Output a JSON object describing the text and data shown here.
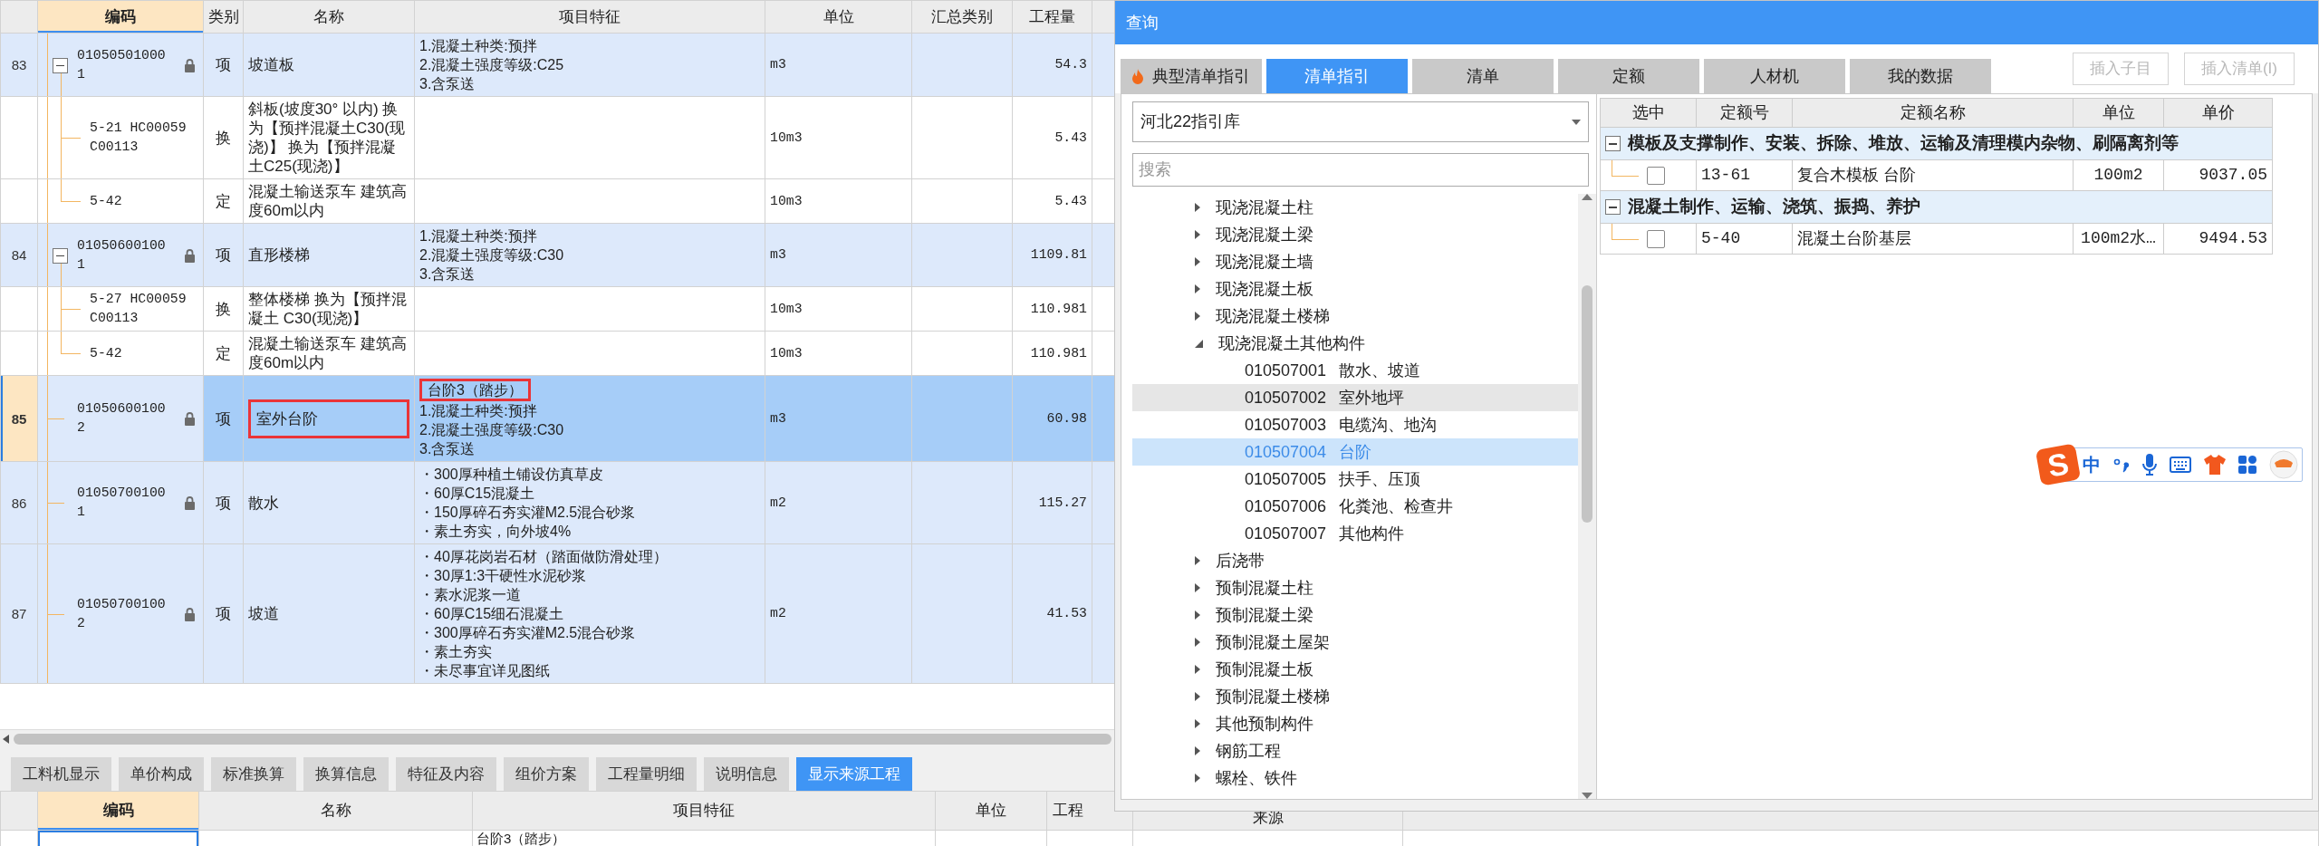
{
  "main_grid": {
    "columns": [
      {
        "label": "编码",
        "selected": true
      },
      {
        "label": "类别",
        "selected": false
      },
      {
        "label": "名称",
        "selected": false
      },
      {
        "label": "项目特征",
        "selected": false
      },
      {
        "label": "单位",
        "selected": false
      },
      {
        "label": "汇总类别",
        "selected": false
      },
      {
        "label": "工程量",
        "selected": false
      }
    ],
    "rows": [
      {
        "kind": "item",
        "no": "83",
        "code": "010505010001",
        "locked": true,
        "expanded": true,
        "type": "项",
        "name": "坡道板",
        "features": [
          "1.混凝土种类:预拌",
          "2.混凝土强度等级:C25",
          "3.含泵送"
        ],
        "unit": "m3",
        "quantity": "54.3",
        "selected": false,
        "highlighted": false
      },
      {
        "kind": "sub",
        "code": "5-21 HC00059 C00113",
        "type": "换",
        "name": "斜板(坡度30° 以内) 换为【预拌混凝土C30(现浇)】 换为【预拌混凝土C25(现浇)】",
        "unit": "10m3",
        "quantity": "5.43",
        "selected": false,
        "highlighted": false
      },
      {
        "kind": "sub",
        "code": "5-42",
        "type": "定",
        "name": "混凝土输送泵车 建筑高度60m以内",
        "unit": "10m3",
        "quantity": "5.43",
        "selected": false,
        "highlighted": false
      },
      {
        "kind": "item",
        "no": "84",
        "code": "010506001001",
        "locked": true,
        "expanded": true,
        "type": "项",
        "name": "直形楼梯",
        "features": [
          "1.混凝土种类:预拌",
          "2.混凝土强度等级:C30",
          "3.含泵送"
        ],
        "unit": "m3",
        "quantity": "1109.81",
        "selected": false,
        "highlighted": false
      },
      {
        "kind": "sub",
        "code": "5-27 HC00059 C00113",
        "type": "换",
        "name": "整体楼梯 换为【预拌混凝土 C30(现浇)】",
        "unit": "10m3",
        "quantity": "110.981",
        "selected": false,
        "highlighted": false
      },
      {
        "kind": "sub",
        "code": "5-42",
        "type": "定",
        "name": "混凝土输送泵车 建筑高度60m以内",
        "unit": "10m3",
        "quantity": "110.981",
        "selected": false,
        "highlighted": false
      },
      {
        "kind": "item",
        "no": "85",
        "code": "010506001002",
        "locked": true,
        "type": "项",
        "name": "室外台阶",
        "features": [
          "台阶3（踏步）",
          "1.混凝土种类:预拌",
          "2.混凝土强度等级:C30",
          "3.含泵送"
        ],
        "unit": "m3",
        "quantity": "60.98",
        "selected": true,
        "highlighted": true
      },
      {
        "kind": "item",
        "no": "86",
        "code": "010507001001",
        "locked": true,
        "type": "项",
        "name": "散水",
        "features": [
          "・300厚种植土铺设仿真草皮",
          "・60厚C15混凝土",
          "・150厚碎石夯实灌M2.5混合砂浆",
          "・素土夯实，向外坡4%"
        ],
        "unit": "m2",
        "quantity": "115.27",
        "selected": false,
        "highlighted": false
      },
      {
        "kind": "item",
        "no": "87",
        "code": "010507001002",
        "locked": true,
        "type": "项",
        "name": "坡道",
        "features": [
          "・40厚花岗岩石材（踏面做防滑处理）",
          "・30厚1:3干硬性水泥砂浆",
          "・素水泥浆一道",
          "・60厚C15细石混凝土",
          "・300厚碎石夯实灌M2.5混合砂浆",
          "・素土夯实",
          "・未尽事宜详见图纸"
        ],
        "unit": "m2",
        "quantity": "41.53",
        "selected": false,
        "highlighted": false
      }
    ]
  },
  "bottom_tabs": [
    {
      "label": "工料机显示",
      "selected": false
    },
    {
      "label": "单价构成",
      "selected": false
    },
    {
      "label": "标准换算",
      "selected": false
    },
    {
      "label": "换算信息",
      "selected": false
    },
    {
      "label": "特征及内容",
      "selected": false
    },
    {
      "label": "组价方案",
      "selected": false
    },
    {
      "label": "工程量明细",
      "selected": false
    },
    {
      "label": "说明信息",
      "selected": false
    },
    {
      "label": "显示来源工程",
      "selected": true
    }
  ],
  "bottom_grid": {
    "columns": [
      {
        "label": "编码",
        "selected": true
      },
      {
        "label": "名称",
        "selected": false
      },
      {
        "label": "项目特征",
        "selected": false
      },
      {
        "label": "单位",
        "selected": false
      },
      {
        "label": "工程",
        "selected": false
      },
      {
        "label": "来源",
        "selected": false
      }
    ],
    "rows": [
      {
        "features": "台阶3（踏步）",
        "selected": true
      }
    ]
  },
  "dialog": {
    "title": "查询",
    "tabs": [
      {
        "label": "典型清单指引",
        "selected": false
      },
      {
        "label": "清单指引",
        "selected": true
      },
      {
        "label": "清单",
        "selected": false
      },
      {
        "label": "定额",
        "selected": false
      },
      {
        "label": "人材机",
        "selected": false
      },
      {
        "label": "我的数据",
        "selected": false
      }
    ],
    "buttons": [
      {
        "label": "插入子目",
        "disabled": true
      },
      {
        "label": "插入清单(I)",
        "disabled": true
      }
    ],
    "library": "河北22指引库",
    "search": {
      "placeholder": "搜索"
    },
    "tree": [
      {
        "label": "现浇混凝土柱",
        "expanded": false
      },
      {
        "label": "现浇混凝土梁",
        "expanded": false
      },
      {
        "label": "现浇混凝土墙",
        "expanded": false
      },
      {
        "label": "现浇混凝土板",
        "expanded": false
      },
      {
        "label": "现浇混凝土楼梯",
        "expanded": false
      },
      {
        "label": "现浇混凝土其他构件",
        "expanded": true,
        "children": [
          {
            "code": "010507001",
            "label": "散水、坡道",
            "selected": false,
            "hovered": false
          },
          {
            "code": "010507002",
            "label": "室外地坪",
            "selected": false,
            "hovered": true
          },
          {
            "code": "010507003",
            "label": "电缆沟、地沟",
            "selected": false,
            "hovered": false
          },
          {
            "code": "010507004",
            "label": "台阶",
            "selected": true,
            "hovered": false
          },
          {
            "code": "010507005",
            "label": "扶手、压顶",
            "selected": false,
            "hovered": false
          },
          {
            "code": "010507006",
            "label": "化粪池、检查井",
            "selected": false,
            "hovered": false
          },
          {
            "code": "010507007",
            "label": "其他构件",
            "selected": false,
            "hovered": false
          }
        ]
      },
      {
        "label": "后浇带",
        "expanded": false
      },
      {
        "label": "预制混凝土柱",
        "expanded": false
      },
      {
        "label": "预制混凝土梁",
        "expanded": false
      },
      {
        "label": "预制混凝土屋架",
        "expanded": false
      },
      {
        "label": "预制混凝土板",
        "expanded": false
      },
      {
        "label": "预制混凝土楼梯",
        "expanded": false
      },
      {
        "label": "其他预制构件",
        "expanded": false
      },
      {
        "label": "钢筋工程",
        "expanded": false
      },
      {
        "label": "螺栓、铁件",
        "expanded": false
      }
    ],
    "grid": {
      "columns": [
        "选中",
        "定额号",
        "定额名称",
        "单位",
        "单价"
      ],
      "groups": [
        {
          "title": "模板及支撑制作、安装、拆除、堆放、运输及清理模内杂物、刷隔离剂等",
          "expanded": true,
          "rows": [
            {
              "checked": false,
              "code": "13-61",
              "name": "复合木模板 台阶",
              "unit": "100m2",
              "price": "9037.05"
            }
          ]
        },
        {
          "title": "混凝土制作、运输、浇筑、振捣、养护",
          "expanded": true,
          "rows": [
            {
              "checked": false,
              "code": "5-40",
              "name": "混凝土台阶基层",
              "unit": "100m2水…",
              "price": "9494.53"
            }
          ]
        }
      ]
    }
  },
  "ime_toolbar": {
    "logo": "S",
    "mode": "中"
  }
}
